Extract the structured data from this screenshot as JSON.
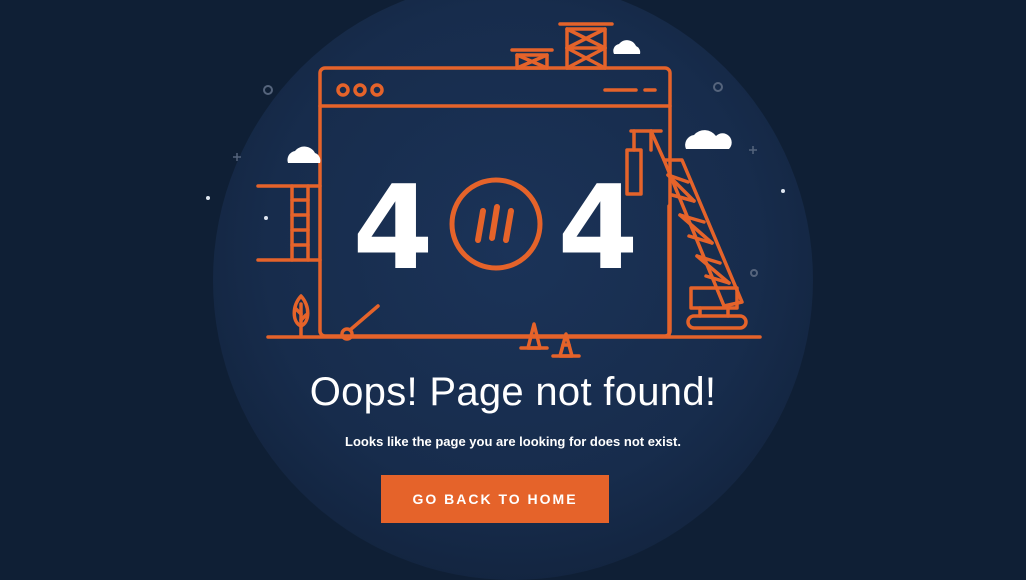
{
  "error": {
    "code_left": "4",
    "code_right": "4",
    "title": "Oops! Page not found!",
    "message": "Looks like the page you are looking for does not exist."
  },
  "actions": {
    "home_label": "GO BACK TO HOME"
  },
  "colors": {
    "background": "#0f1f35",
    "accent": "#e5632a",
    "text": "#ffffff"
  }
}
